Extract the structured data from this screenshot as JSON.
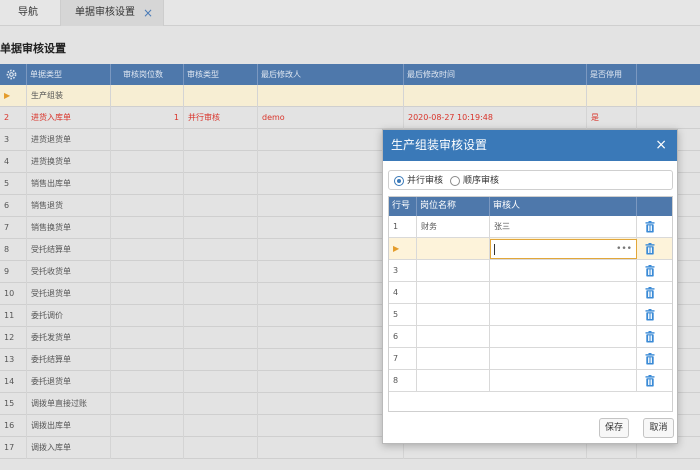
{
  "tabs": {
    "nav_label": "导航",
    "active_label": "单据审核设置",
    "close_glyph": "×"
  },
  "page_title": "单据审核设置",
  "grid": {
    "columns": [
      "单据类型",
      "审核岗位数",
      "审核类型",
      "最后修改人",
      "最后修改时间",
      "是否停用"
    ],
    "rows": [
      {
        "num": "",
        "type": "生产组装",
        "count": "",
        "audit": "",
        "modifier": "",
        "time": "",
        "disabled": ""
      },
      {
        "num": "2",
        "type": "进货入库单",
        "count": "1",
        "audit": "并行审核",
        "modifier": "demo",
        "time": "2020-08-27 10:19:48",
        "disabled": "是"
      },
      {
        "num": "3",
        "type": "进货退货单",
        "count": "",
        "audit": "",
        "modifier": "",
        "time": "",
        "disabled": ""
      },
      {
        "num": "4",
        "type": "进货换货单",
        "count": "",
        "audit": "",
        "modifier": "",
        "time": "",
        "disabled": ""
      },
      {
        "num": "5",
        "type": "销售出库单",
        "count": "",
        "audit": "",
        "modifier": "",
        "time": "",
        "disabled": ""
      },
      {
        "num": "6",
        "type": "销售退货",
        "count": "",
        "audit": "",
        "modifier": "",
        "time": "",
        "disabled": ""
      },
      {
        "num": "7",
        "type": "销售换货单",
        "count": "",
        "audit": "",
        "modifier": "",
        "time": "",
        "disabled": ""
      },
      {
        "num": "8",
        "type": "受托结算单",
        "count": "",
        "audit": "",
        "modifier": "",
        "time": "",
        "disabled": ""
      },
      {
        "num": "9",
        "type": "受托收货单",
        "count": "",
        "audit": "",
        "modifier": "",
        "time": "",
        "disabled": ""
      },
      {
        "num": "10",
        "type": "受托退货单",
        "count": "",
        "audit": "",
        "modifier": "",
        "time": "",
        "disabled": ""
      },
      {
        "num": "11",
        "type": "委托调价",
        "count": "",
        "audit": "",
        "modifier": "",
        "time": "",
        "disabled": ""
      },
      {
        "num": "12",
        "type": "委托发货单",
        "count": "",
        "audit": "",
        "modifier": "",
        "time": "",
        "disabled": ""
      },
      {
        "num": "13",
        "type": "委托结算单",
        "count": "",
        "audit": "",
        "modifier": "",
        "time": "",
        "disabled": ""
      },
      {
        "num": "14",
        "type": "委托退货单",
        "count": "",
        "audit": "",
        "modifier": "",
        "time": "",
        "disabled": ""
      },
      {
        "num": "15",
        "type": "调拨单直接过账",
        "count": "",
        "audit": "",
        "modifier": "",
        "time": "",
        "disabled": ""
      },
      {
        "num": "16",
        "type": "调拨出库单",
        "count": "",
        "audit": "",
        "modifier": "",
        "time": "",
        "disabled": ""
      },
      {
        "num": "17",
        "type": "调拨入库单",
        "count": "",
        "audit": "",
        "modifier": "",
        "time": "",
        "disabled": ""
      }
    ]
  },
  "modal": {
    "title": "生产组装审核设置",
    "close_glyph": "×",
    "radio_parallel": "并行审核",
    "radio_sequential": "顺序审核",
    "selected_mode": "并行审核",
    "columns": [
      "行号",
      "岗位名称",
      "审核人"
    ],
    "rows": [
      {
        "num": "1",
        "position": "财务",
        "auditor": "张三"
      },
      {
        "num": "",
        "position": "",
        "auditor": ""
      },
      {
        "num": "3",
        "position": "",
        "auditor": ""
      },
      {
        "num": "4",
        "position": "",
        "auditor": ""
      },
      {
        "num": "5",
        "position": "",
        "auditor": ""
      },
      {
        "num": "6",
        "position": "",
        "auditor": ""
      },
      {
        "num": "7",
        "position": "",
        "auditor": ""
      },
      {
        "num": "8",
        "position": "",
        "auditor": ""
      }
    ],
    "ellipsis": "•••",
    "save_label": "保存",
    "cancel_label": "取消"
  },
  "colors": {
    "header_blue": "#4e78ab",
    "modal_blue": "#3a79b8",
    "selected_row": "#f7eed3",
    "highlight_red": "#d9342b",
    "arrow_orange": "#e49b2a"
  }
}
